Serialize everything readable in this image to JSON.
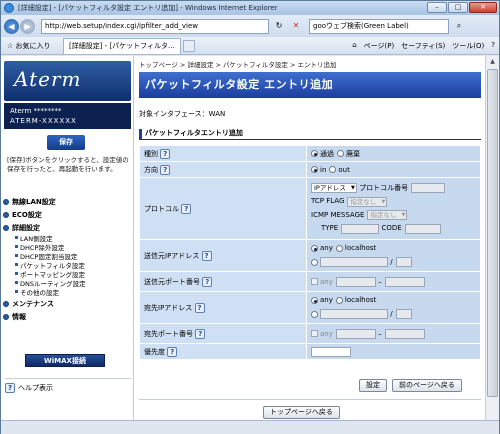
{
  "window": {
    "title": "[詳細設定] - [パケットフィルタ設定 エントリ追加] - Windows Internet Explorer",
    "min": "–",
    "max": "□",
    "close": "✕"
  },
  "address": {
    "url": "http://web.setup/index.cgi/ipfilter_add_view",
    "search_text": "gooウェブ検索(Green Label)"
  },
  "commandbar": {
    "favorites": "お気に入り",
    "tab_label": "[詳細設定] - [パケットフィルタ...",
    "items": [
      "ページ(P)",
      "セーフティ(S)",
      "ツール(O)",
      "?"
    ]
  },
  "sidebar": {
    "logo_text": "Aterm",
    "model_line1": "Aterm ********",
    "model_line2": "ATERM-XXXXXX",
    "save_label": "保存",
    "save_help": "[保存]ボタンをクリックすると、設定値の保存を行ったと、再起動を行います。",
    "menu": [
      {
        "label": "無線LAN設定"
      },
      {
        "label": "ECO設定"
      },
      {
        "label": "詳細設定"
      }
    ],
    "submenu": [
      "LAN側設定",
      "DHCP除外設定",
      "DHCP固定割当設定",
      "パケットフィルタ設定",
      "ポートマッピング設定",
      "DNSルーティング設定",
      "その他の設定"
    ],
    "menu2": [
      {
        "label": "メンテナンス"
      },
      {
        "label": "情報"
      }
    ],
    "wimax_label": "WiMAX接続",
    "help_label": "ヘルプ表示"
  },
  "main": {
    "breadcrumb": "トップページ > 詳細設定 > パケットフィルタ設定 > エントリ追加",
    "title": "パケットフィルタ設定 エントリ追加",
    "interface": "対象インタフェース：WAN",
    "section": "パケットフィルタエントリ追加",
    "rows": {
      "type": {
        "label": "種別",
        "opt1": "通過",
        "opt2": "廃棄"
      },
      "direction": {
        "label": "方向",
        "opt1": "in",
        "opt2": "out"
      },
      "protocol": {
        "label": "プロトコル",
        "select": "IPアドレス",
        "proto_no": "プロトコル番号",
        "tcp_flag": "TCP FLAG",
        "tcp_sel": "指定なし",
        "icmp": "ICMP MESSAGE",
        "icmp_sel": "指定なし",
        "type_lbl": "TYPE",
        "code_lbl": "CODE"
      },
      "src_ip": {
        "label": "送信元IPアドレス",
        "opt1": "any",
        "opt2": "localhost",
        "slash": "/"
      },
      "src_port": {
        "label": "送信元ポート番号",
        "any": "any",
        "dash": "–"
      },
      "dst_ip": {
        "label": "宛先IPアドレス",
        "opt1": "any",
        "opt2": "localhost",
        "slash": "/"
      },
      "dst_port": {
        "label": "宛先ポート番号",
        "any": "any",
        "dash": "–"
      },
      "priority": {
        "label": "優先度"
      }
    },
    "set_button": "設定",
    "back_button": "前のページへ戻る",
    "top_button": "トップページへ戻る"
  }
}
